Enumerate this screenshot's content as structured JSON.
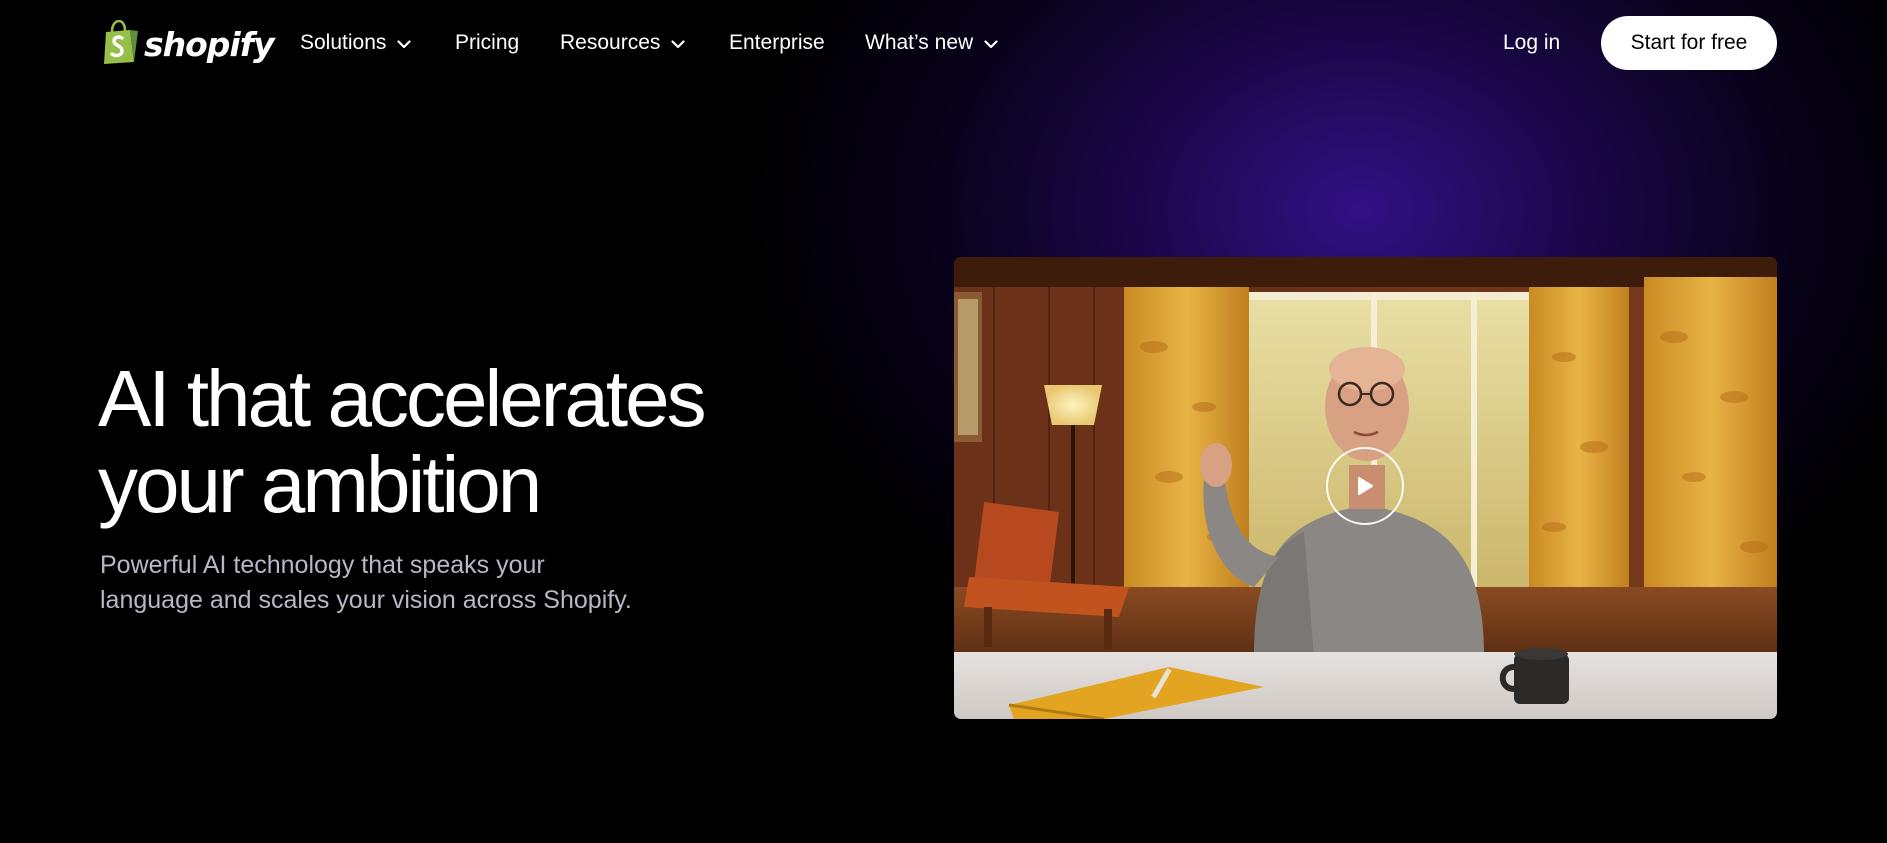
{
  "brand": {
    "name": "shopify",
    "logo_color": "#95BF47"
  },
  "nav": {
    "items": [
      {
        "label": "Solutions",
        "has_dropdown": true
      },
      {
        "label": "Pricing",
        "has_dropdown": false
      },
      {
        "label": "Resources",
        "has_dropdown": true
      },
      {
        "label": "Enterprise",
        "has_dropdown": false
      },
      {
        "label": "What’s new",
        "has_dropdown": true
      }
    ],
    "login_label": "Log in",
    "cta_label": "Start for free"
  },
  "hero": {
    "title_line1": "AI that accelerates",
    "title_line2": "your ambition",
    "subtitle_line1": "Powerful AI technology that speaks your",
    "subtitle_line2": "language and scales your vision across Shopify."
  },
  "video": {
    "play_icon": "play-icon"
  },
  "colors": {
    "background": "#000000",
    "glow": "#2A0E8A",
    "cta_background": "#FFFFFF",
    "subtitle_text": "#B9B6C6"
  }
}
